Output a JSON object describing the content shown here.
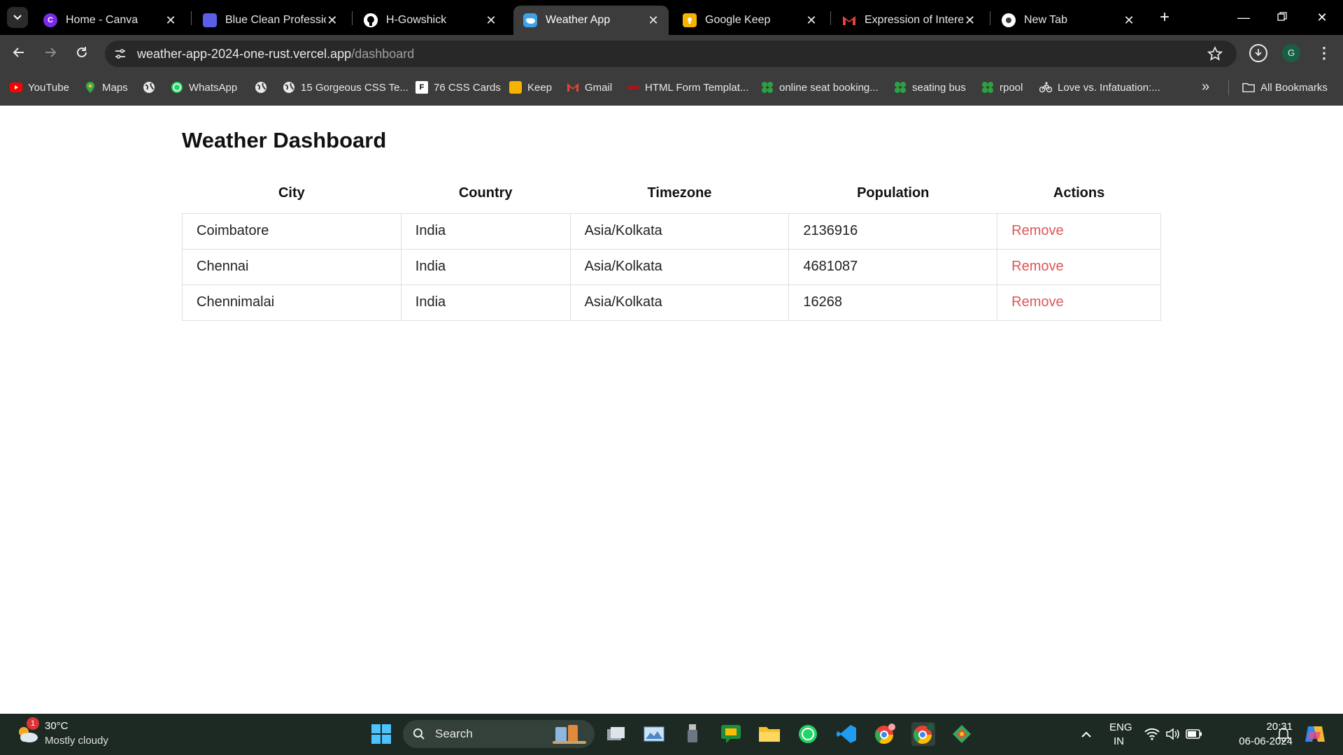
{
  "browser": {
    "tabs": [
      {
        "title": "Home - Canva",
        "icon": "canva-icon",
        "color": "#7d2ae8"
      },
      {
        "title": "Blue Clean Profession",
        "icon": "canva-doc-icon",
        "color": "#5b5fe8"
      },
      {
        "title": "H-Gowshick",
        "icon": "github-icon",
        "color": "#ffffff"
      },
      {
        "title": "Weather App",
        "icon": "weather-icon",
        "color": "#3ba3e8",
        "active": true
      },
      {
        "title": "Google Keep",
        "icon": "keep-icon",
        "color": "#f6b400"
      },
      {
        "title": "Expression of Interes",
        "icon": "gmail-icon",
        "color": "#ea4335"
      },
      {
        "title": "New Tab",
        "icon": "chrome-icon",
        "color": "#ffffff"
      }
    ],
    "url_host": "weather-app-2024-one-rust.vercel.app",
    "url_path": "/dashboard",
    "profile_initial": "G",
    "bookmarks": [
      {
        "label": "YouTube",
        "icon": "youtube-icon"
      },
      {
        "label": "Maps",
        "icon": "maps-icon"
      },
      {
        "label": "",
        "icon": "globe-icon"
      },
      {
        "label": "WhatsApp",
        "icon": "whatsapp-icon"
      },
      {
        "label": "",
        "icon": "globe-icon"
      },
      {
        "label": "15 Gorgeous CSS Te...",
        "icon": "globe-icon"
      },
      {
        "label": "76 CSS Cards",
        "icon": "f-icon"
      },
      {
        "label": "Keep",
        "icon": "keep-icon"
      },
      {
        "label": "Gmail",
        "icon": "gmail-icon"
      },
      {
        "label": "HTML Form Templat...",
        "icon": "form-icon"
      },
      {
        "label": "online seat booking...",
        "icon": "clover-icon"
      },
      {
        "label": "seating bus",
        "icon": "clover-icon"
      },
      {
        "label": "rpool",
        "icon": "clover-icon"
      },
      {
        "label": "Love vs. Infatuation:...",
        "icon": "bike-icon"
      }
    ],
    "all_bookmarks_label": "All Bookmarks"
  },
  "dashboard": {
    "title": "Weather Dashboard",
    "columns": [
      "City",
      "Country",
      "Timezone",
      "Population",
      "Actions"
    ],
    "rows": [
      {
        "city": "Coimbatore",
        "country": "India",
        "timezone": "Asia/Kolkata",
        "population": "2136916",
        "action": "Remove"
      },
      {
        "city": "Chennai",
        "country": "India",
        "timezone": "Asia/Kolkata",
        "population": "4681087",
        "action": "Remove"
      },
      {
        "city": "Chennimalai",
        "country": "India",
        "timezone": "Asia/Kolkata",
        "population": "16268",
        "action": "Remove"
      }
    ],
    "remove_color": "#e05656"
  },
  "taskbar": {
    "weather_temp": "30°C",
    "weather_condition": "Mostly cloudy",
    "weather_badge": "1",
    "search_label": "Search",
    "lang_line1": "ENG",
    "lang_line2": "IN",
    "time": "20:31",
    "date": "06-06-2024"
  }
}
